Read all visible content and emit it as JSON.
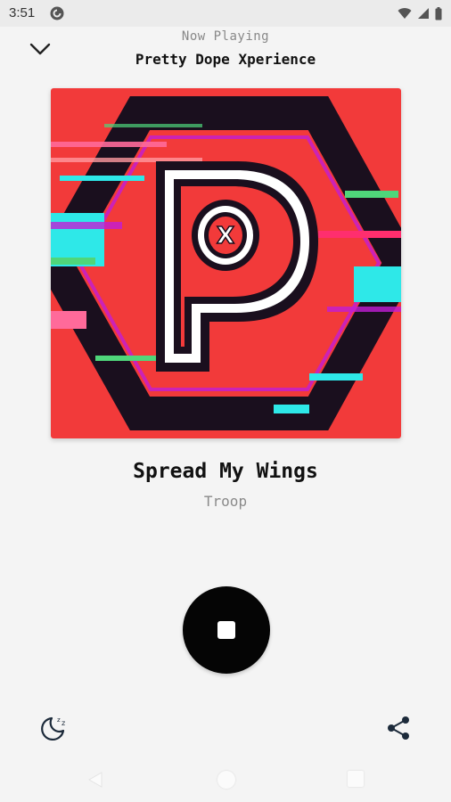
{
  "status_bar": {
    "time": "3:51",
    "app_icon": "pocket-casts-icon",
    "icons": [
      "wifi-icon",
      "signal-icon",
      "battery-icon"
    ]
  },
  "header": {
    "collapse_icon": "chevron-down-icon",
    "label": "Now Playing",
    "station": "Pretty Dope Xperience"
  },
  "artwork": {
    "letter": "P",
    "badge": "X",
    "colors": {
      "background": "#f23a3a",
      "hexagon": "#1a0f1e",
      "glitch_cyan": "#2ee8e8",
      "glitch_magenta": "#c21dd6",
      "glitch_pink": "#ff2e6e",
      "glitch_green": "#4fd67a"
    }
  },
  "track": {
    "title": "Spread My Wings",
    "artist": "Troop"
  },
  "controls": {
    "stop_icon": "stop-icon",
    "sleep_icon": "sleep-timer-icon",
    "share_icon": "share-icon"
  },
  "colors": {
    "accent": "#000000",
    "background": "#f4f4f4"
  },
  "nav": {
    "icons": [
      "back-icon",
      "home-icon",
      "recents-icon"
    ]
  }
}
